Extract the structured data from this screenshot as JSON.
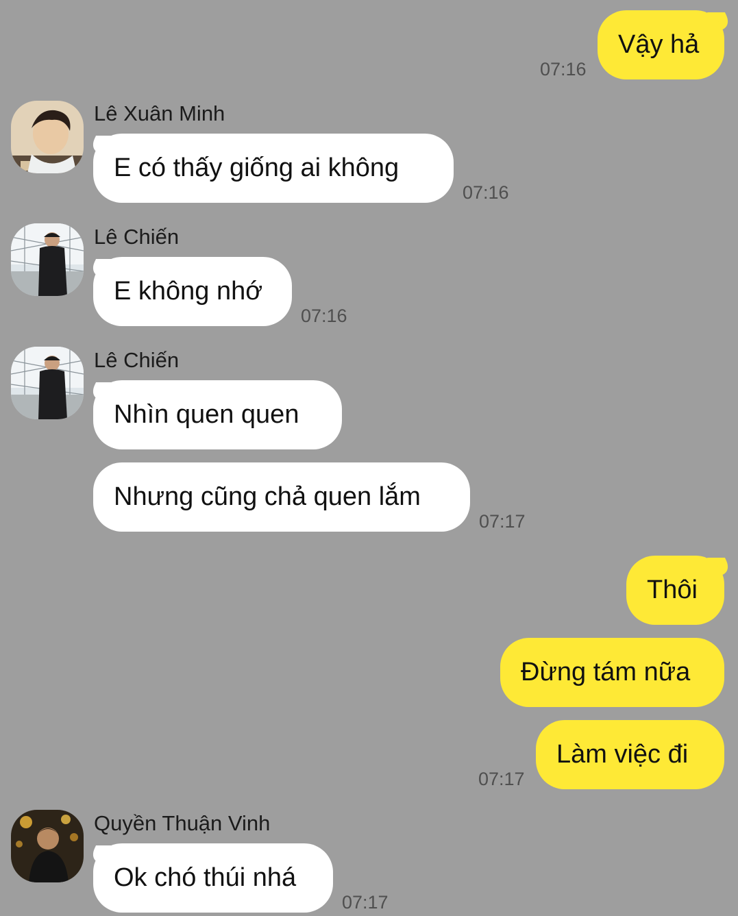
{
  "conversation": {
    "m1": {
      "text": "Vậy hả",
      "time": "07:16"
    },
    "m2": {
      "sender": "Lê Xuân Minh",
      "text": "E có thấy giống ai không",
      "time": "07:16"
    },
    "m3": {
      "sender": "Lê Chiến",
      "text": "E không nhớ",
      "time": "07:16"
    },
    "m4": {
      "sender": "Lê Chiến",
      "texts": [
        "Nhìn quen quen",
        "Nhưng cũng chả quen lắm"
      ],
      "time": "07:17"
    },
    "m5": {
      "texts": [
        "Thôi",
        "Đừng tám nữa",
        "Làm việc đi"
      ],
      "time": "07:17"
    },
    "m6": {
      "sender": "Quyền Thuận Vinh",
      "text": "Ok chó thúi nhá",
      "time": "07:17"
    }
  },
  "colors": {
    "background": "#9e9e9e",
    "incoming_bubble": "#ffffff",
    "outgoing_bubble": "#fee936",
    "timestamp": "#4f4f4f"
  }
}
